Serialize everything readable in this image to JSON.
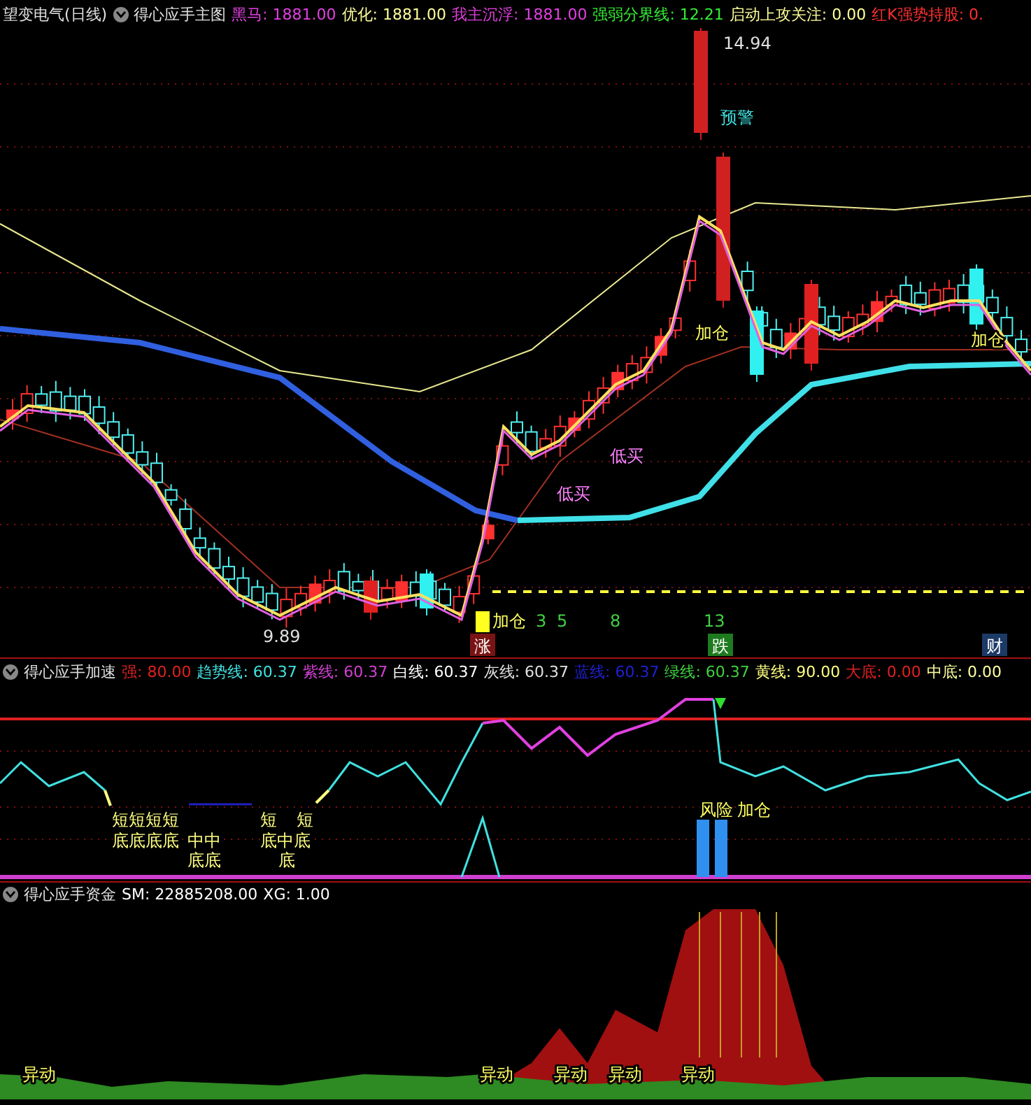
{
  "main_panel": {
    "header": {
      "stock": "望变电气(日线)",
      "indicator": "得心应手主图",
      "values": [
        {
          "text": "黑马: 1881.00",
          "color": "#e040e0"
        },
        {
          "text": "优化: 1881.00",
          "color": "#ffff99"
        },
        {
          "text": "我主沉浮: 1881.00",
          "color": "#e040e0"
        },
        {
          "text": "强弱分界线: 12.21",
          "color": "#33ee33"
        },
        {
          "text": "启动上攻关注: 0.00",
          "color": "#ffff99"
        },
        {
          "text": "红K强势持股: 0.",
          "color": "#ff3030"
        }
      ]
    },
    "labels": [
      {
        "kind": "price",
        "text": "14.94"
      },
      {
        "kind": "warn",
        "text": "预警"
      },
      {
        "kind": "buy",
        "text": "加仓"
      },
      {
        "kind": "buy",
        "text": "加仓"
      },
      {
        "kind": "dip",
        "text": "低买"
      },
      {
        "kind": "dip",
        "text": "低买"
      },
      {
        "kind": "price",
        "text": "9.89"
      },
      {
        "kind": "buy",
        "text": "加仓"
      },
      {
        "kind": "count",
        "text": "3"
      },
      {
        "kind": "count",
        "text": "5"
      },
      {
        "kind": "count",
        "text": "8"
      },
      {
        "kind": "count",
        "text": "13"
      }
    ],
    "tags": [
      {
        "text": "涨",
        "color": "#7a1414"
      },
      {
        "text": "跌",
        "color": "#1e7a1e"
      },
      {
        "text": "财",
        "color": "#1c3a66"
      }
    ]
  },
  "speed_panel": {
    "header": {
      "indicator": "得心应手加速",
      "values": [
        {
          "text": "强: 80.00",
          "color": "#e02020"
        },
        {
          "text": "趋势线: 60.37",
          "color": "#40e0e0"
        },
        {
          "text": "紫线: 60.37",
          "color": "#d040d0"
        },
        {
          "text": "白线: 60.37",
          "color": "#ffffff"
        },
        {
          "text": "灰线: 60.37",
          "color": "#e0e0e0"
        },
        {
          "text": "蓝线: 60.37",
          "color": "#2020d0"
        },
        {
          "text": "绿线: 60.37",
          "color": "#40d040"
        },
        {
          "text": "黄线: 90.00",
          "color": "#ffff80"
        },
        {
          "text": "大底: 0.00",
          "color": "#e02020"
        },
        {
          "text": "中底: 0.00",
          "color": "#ffffa0"
        }
      ]
    },
    "labels": [
      {
        "kind": "bottom",
        "text": "短短短短"
      },
      {
        "kind": "bottom",
        "text": "底底底底"
      },
      {
        "kind": "bottom",
        "text": "中中"
      },
      {
        "kind": "bottom",
        "text": "底底"
      },
      {
        "kind": "bottom",
        "text": "短"
      },
      {
        "kind": "bottom",
        "text": "短"
      },
      {
        "kind": "bottom",
        "text": "底中底"
      },
      {
        "kind": "bottom",
        "text": "底"
      },
      {
        "kind": "risk",
        "text": "风险"
      },
      {
        "kind": "risk",
        "text": "加仓"
      }
    ]
  },
  "fund_panel": {
    "header": {
      "indicator": "得心应手资金",
      "values": [
        {
          "text": "SM: 22885208.00",
          "color": "#ffffff"
        },
        {
          "text": "XG: 1.00",
          "color": "#ffffff"
        }
      ]
    },
    "labels": [
      {
        "text": "异动"
      },
      {
        "text": "异动"
      },
      {
        "text": "异动"
      },
      {
        "text": "异动"
      },
      {
        "text": "异动"
      }
    ]
  }
}
